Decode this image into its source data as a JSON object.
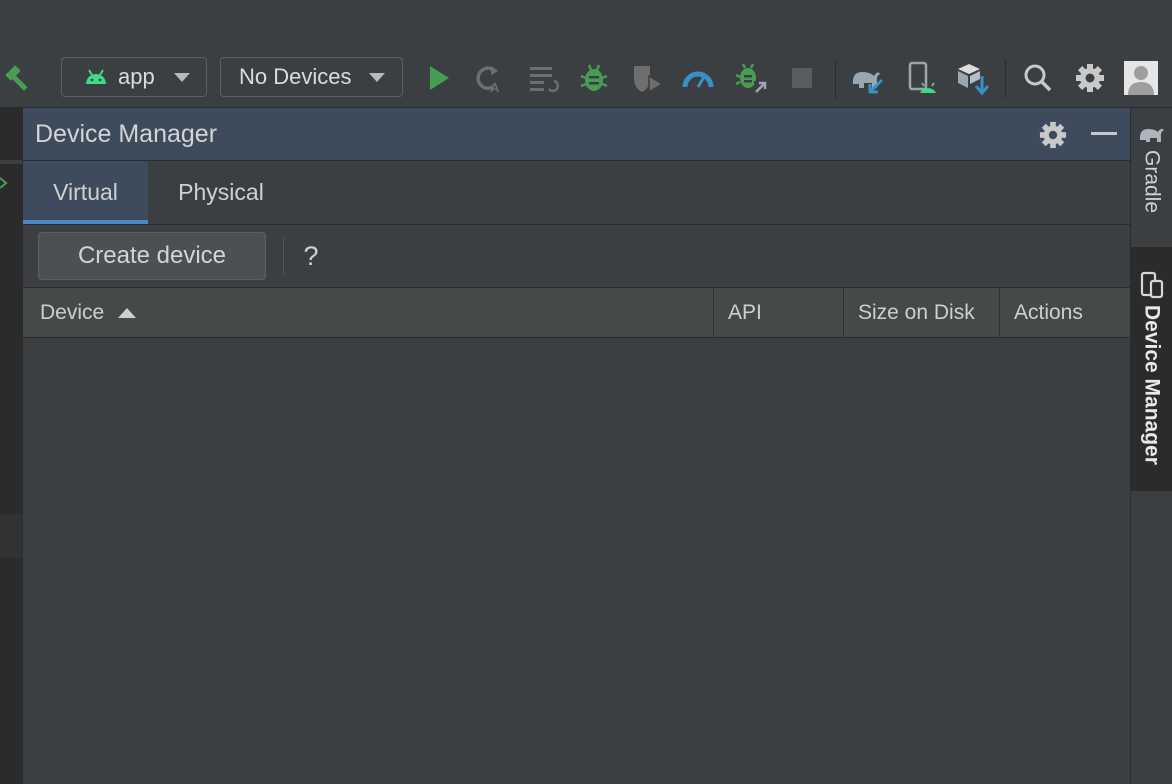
{
  "toolbar": {
    "module_combo": {
      "label": "app",
      "icon": "android-icon"
    },
    "device_combo": {
      "label": "No Devices"
    },
    "icons": [
      "hammer-icon",
      "run-icon",
      "apply-changes-icon",
      "apply-code-changes-icon",
      "debug-icon",
      "coverage-icon",
      "profile-icon",
      "attach-debugger-icon",
      "stop-icon",
      "gradle-sync-icon",
      "device-manager-icon",
      "sdk-manager-icon",
      "search-icon",
      "settings-icon",
      "avatar"
    ]
  },
  "panel": {
    "title": "Device Manager",
    "tabs": [
      {
        "label": "Virtual",
        "active": true
      },
      {
        "label": "Physical",
        "active": false
      }
    ],
    "create_button": "Create device",
    "help_label": "?",
    "table": {
      "columns": [
        "Device",
        "API",
        "Size on Disk",
        "Actions"
      ],
      "sort_column": "Device",
      "sort_direction": "ascending",
      "rows": []
    }
  },
  "side_tabs": [
    {
      "label": "Gradle",
      "active": false
    },
    {
      "label": "Device Manager",
      "active": true
    }
  ],
  "colors": {
    "accent": "#4a88c7",
    "run_green": "#499c54",
    "android_green": "#3ddc84",
    "blue_icon": "#3592c4"
  }
}
